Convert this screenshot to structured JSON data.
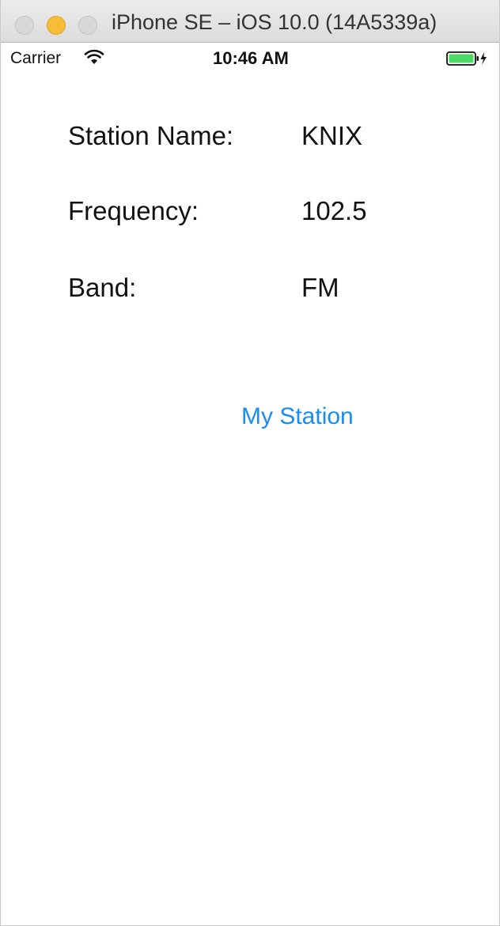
{
  "window": {
    "title": "iPhone SE – iOS 10.0 (14A5339a)"
  },
  "status_bar": {
    "carrier": "Carrier",
    "time": "10:46 AM",
    "icons": [
      "wifi-icon",
      "battery-icon",
      "charging-bolt-icon"
    ]
  },
  "station": {
    "rows": [
      {
        "label": "Station Name:",
        "value": "KNIX"
      },
      {
        "label": "Frequency:",
        "value": "102.5"
      },
      {
        "label": "Band:",
        "value": "FM"
      }
    ]
  },
  "actions": {
    "my_station_label": "My Station"
  },
  "colors": {
    "link": "#1a8cf0",
    "battery": "#4cd964",
    "minimize": "#f6be38"
  }
}
